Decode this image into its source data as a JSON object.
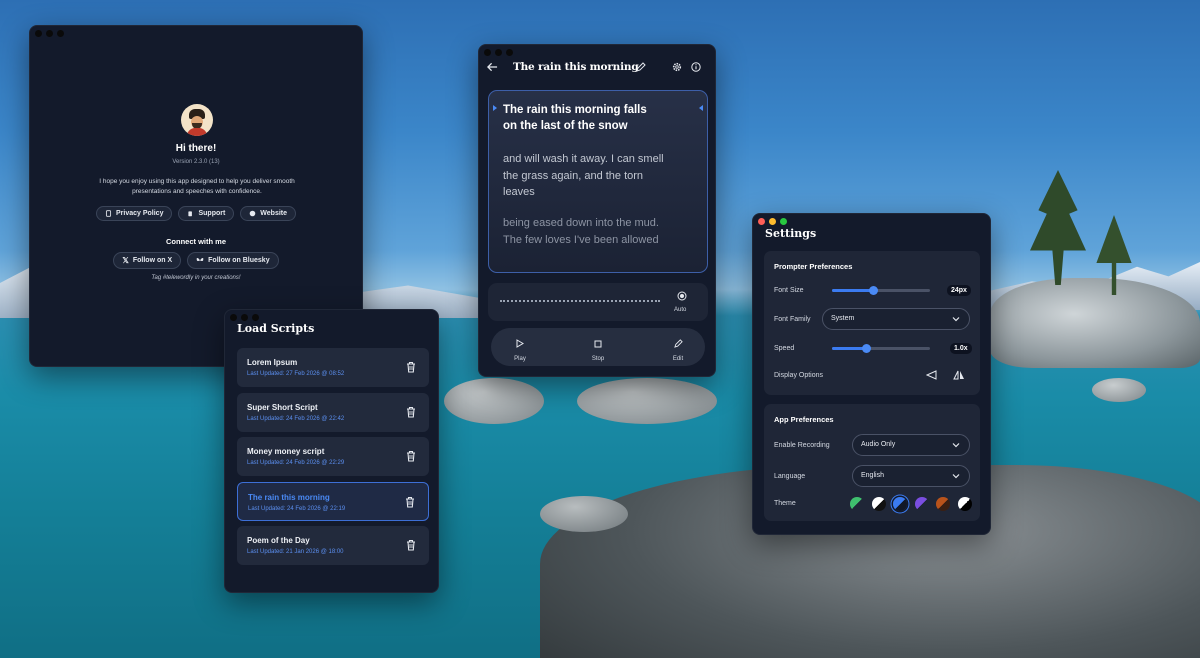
{
  "about": {
    "title": "Hi there!",
    "version": "Version 2.3.0 (13)",
    "description": "I hope you enjoy using this app designed to help you deliver smooth presentations and speeches with confidence.",
    "links": [
      "Privacy Policy",
      "Support",
      "Website"
    ],
    "connect_label": "Connect with me",
    "social": [
      "Follow on X",
      "Follow on Bluesky"
    ],
    "tagline": "Tag #telewordly in your creations!"
  },
  "load_scripts": {
    "title": "Load Scripts",
    "items": [
      {
        "name": "Lorem Ipsum",
        "updated": "Last Updated: 27 Feb 2026 @ 08:52",
        "selected": false
      },
      {
        "name": "Super Short Script",
        "updated": "Last Updated: 24 Feb 2026 @ 22:42",
        "selected": false
      },
      {
        "name": "Money money script",
        "updated": "Last Updated: 24 Feb 2026 @ 22:29",
        "selected": false
      },
      {
        "name": "The rain this morning",
        "updated": "Last Updated: 24 Feb 2026 @ 22:19",
        "selected": true
      },
      {
        "name": "Poem of the Day",
        "updated": "Last Updated: 21 Jan 2026 @ 18:00",
        "selected": false
      }
    ]
  },
  "prompter": {
    "title": "The rain this morning",
    "lines_active": [
      "The rain this morning falls",
      "on the last of the snow"
    ],
    "para2": [
      "and will wash it away. I can smell",
      "the grass again, and the torn",
      "leaves"
    ],
    "para3": [
      "being eased down into the mud.",
      "The few loves I've been allowed"
    ],
    "auto_label": "Auto",
    "controls": {
      "play": "Play",
      "stop": "Stop",
      "edit": "Edit"
    }
  },
  "settings": {
    "title": "Settings",
    "prompter_section": "Prompter Preferences",
    "font_size_label": "Font Size",
    "font_size_value": "24px",
    "font_size_fraction": 0.42,
    "font_family_label": "Font Family",
    "font_family_value": "System",
    "speed_label": "Speed",
    "speed_value": "1.0x",
    "speed_fraction": 0.35,
    "display_options_label": "Display Options",
    "app_section": "App Preferences",
    "recording_label": "Enable Recording",
    "recording_value": "Audio Only",
    "language_label": "Language",
    "language_value": "English",
    "theme_label": "Theme",
    "theme_swatches": [
      {
        "a": "#3fbf6e",
        "b": "#1f2637"
      },
      {
        "a": "#ffffff",
        "b": "#111111"
      },
      {
        "a": "#3b7bf0",
        "b": "#111827"
      },
      {
        "a": "#7a4ee0",
        "b": "#1f2637"
      },
      {
        "a": "#b9531b",
        "b": "#3a1f12"
      },
      {
        "a": "#ffffff",
        "b": "#000000"
      }
    ],
    "accent": "#3b7bf0"
  }
}
